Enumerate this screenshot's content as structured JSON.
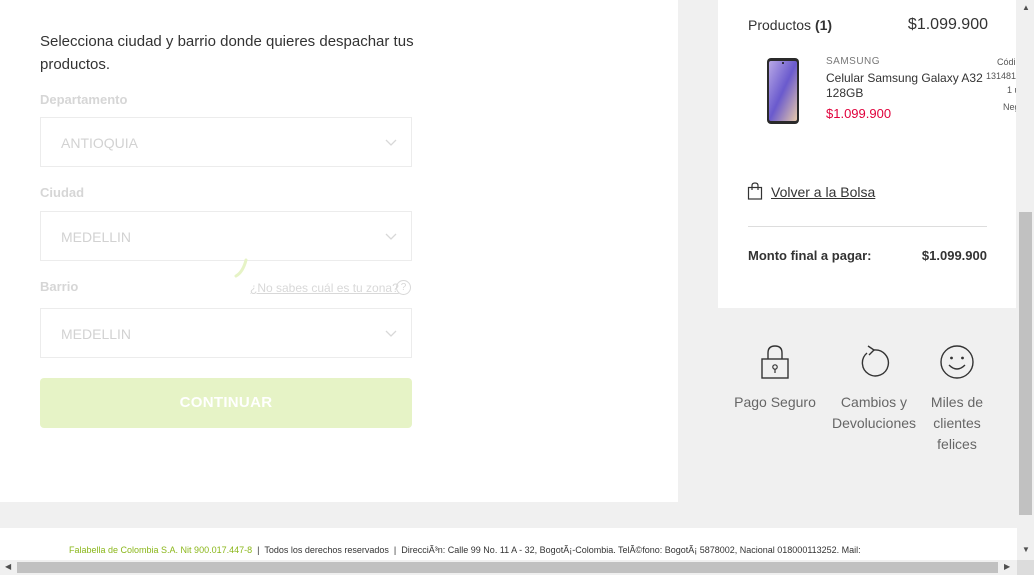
{
  "form": {
    "intro": "Selecciona ciudad y barrio donde quieres despachar tus productos.",
    "departamento_label": "Departamento",
    "departamento_value": "ANTIOQUIA",
    "ciudad_label": "Ciudad",
    "ciudad_value": "MEDELLIN",
    "barrio_label": "Barrio",
    "barrio_value": "MEDELLIN",
    "help_link": "¿No sabes cuál es tu zona?",
    "help_icon_glyph": "?",
    "continue_label": "CONTINUAR"
  },
  "summary": {
    "products_label": "Productos",
    "products_count": "(1)",
    "products_total": "$1.099.900",
    "item": {
      "brand": "SAMSUNG",
      "name": "Celular Samsung Galaxy A32 128GB",
      "price": "$1.099.900",
      "code_label": "Códi",
      "code_value": "131481",
      "qty": "1 u",
      "color": "Neg"
    },
    "back_link": "Volver a la Bolsa",
    "final_label": "Monto final a pagar:",
    "final_value": "$1.099.900"
  },
  "benefits": [
    {
      "icon": "padlock-icon",
      "label": "Pago Seguro"
    },
    {
      "icon": "refresh-icon",
      "label": "Cambios y Devoluciones"
    },
    {
      "icon": "smiley-icon",
      "label": "Miles de clientes felices"
    }
  ],
  "footer": {
    "company": "Falabella de Colombia S.A. Nit 900.017.447-8",
    "separator": "|",
    "rights": "Todos los derechos reservados",
    "address": "DirecciÃ³n: Calle 99 No. 11 A - 32, BogotÃ¡-Colombia. TelÃ©fono: BogotÃ¡ 5878002, Nacional 018000113252. Mail:"
  },
  "colors": {
    "accent_green": "#8bb71b",
    "price_red": "#e0003b",
    "button_disabled": "#e6f3c6"
  }
}
